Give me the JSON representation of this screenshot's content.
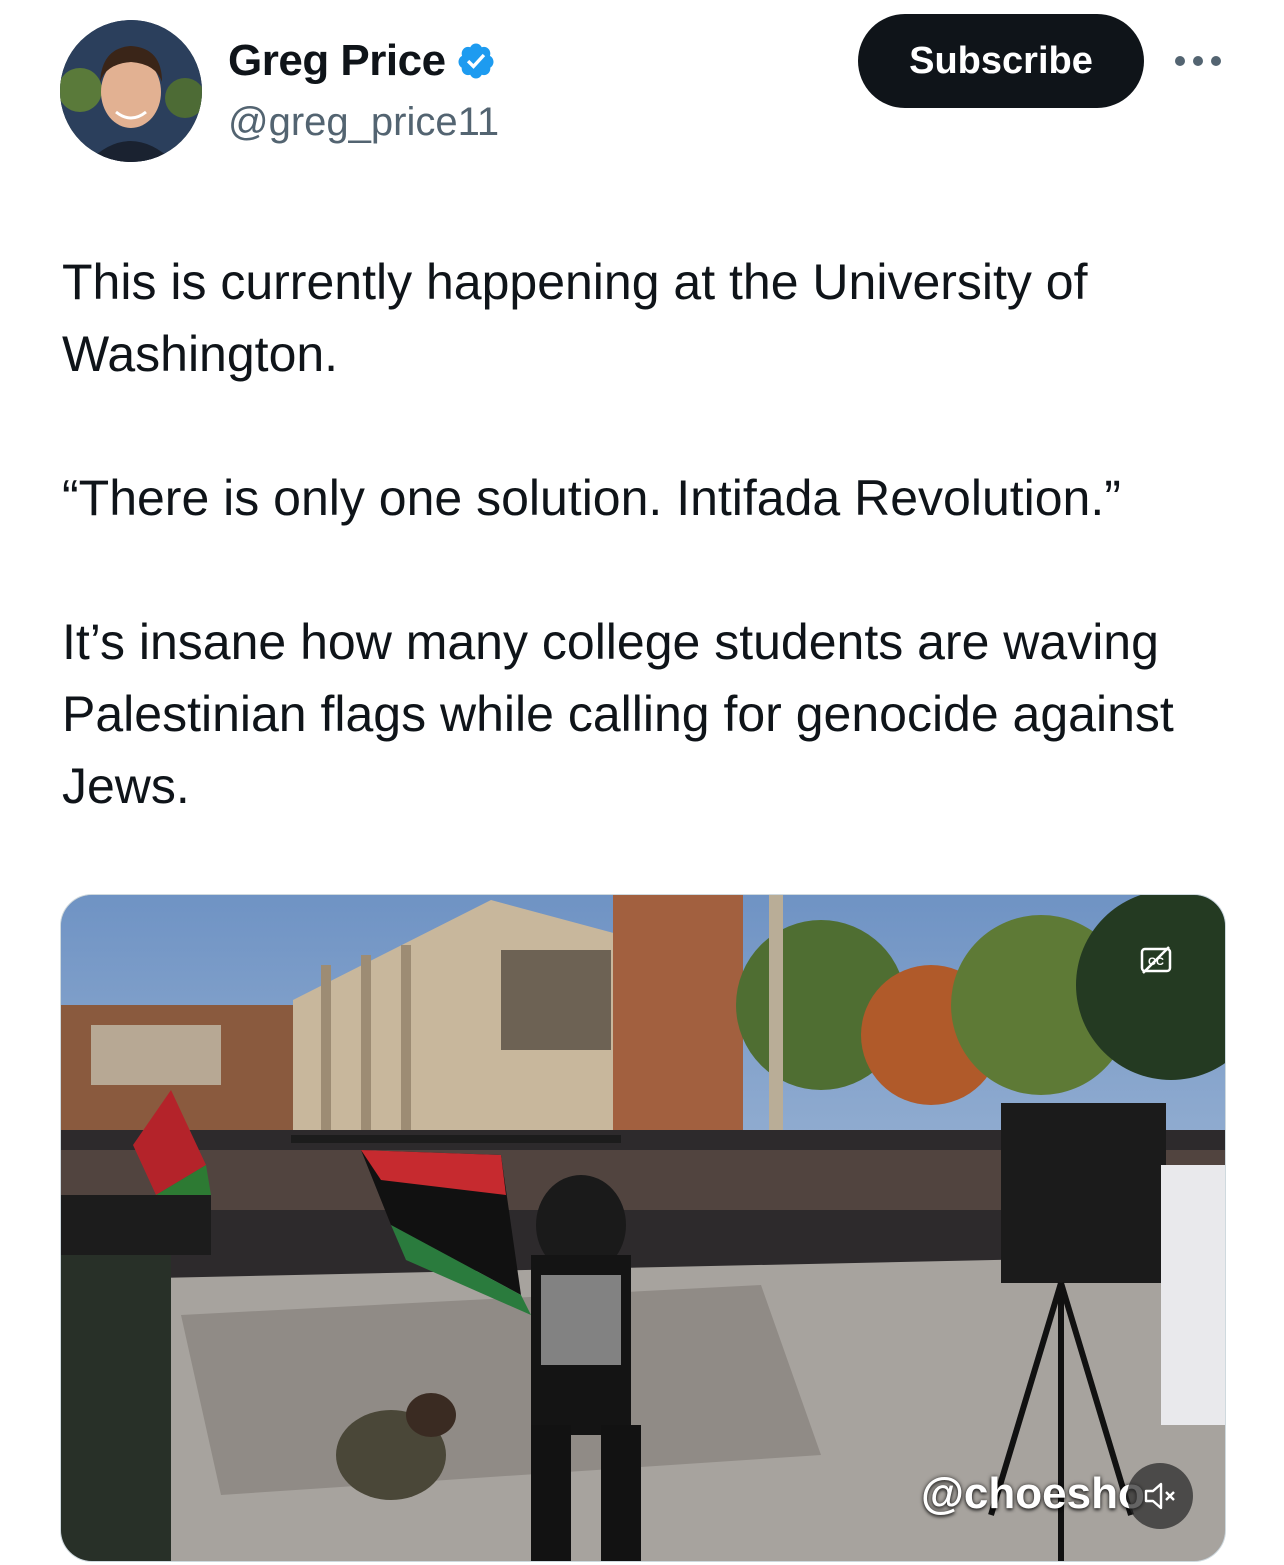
{
  "author": {
    "name": "Greg Price",
    "handle": "@greg_price11",
    "verified": true,
    "verified_color": "#1d9bf0"
  },
  "actions": {
    "subscribe_label": "Subscribe",
    "more_icon": "more-horizontal-icon"
  },
  "tweet": {
    "paragraphs": [
      "This is currently happening at the University of Washington.",
      "“There is only one solution. Intifada Revolution.”",
      "It’s insane how many college students are waving Palestinian flags while calling for genocide against Jews."
    ]
  },
  "media": {
    "type": "video",
    "watermark": "@choesho",
    "icons": [
      "closed-captions-icon",
      "muted-speaker-icon"
    ]
  },
  "colors": {
    "text": "#0f1419",
    "secondary_text": "#536471",
    "button_bg": "#0f1419"
  }
}
